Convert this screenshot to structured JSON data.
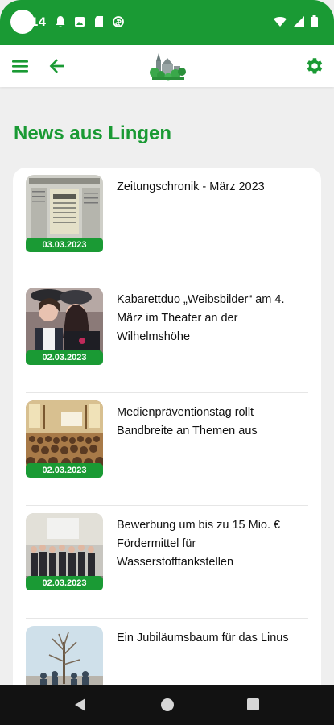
{
  "status_bar": {
    "time": "14",
    "icons": [
      "notification-bell-icon",
      "photo-icon",
      "sd-card-icon",
      "coin-icon"
    ],
    "right_icons": [
      "wifi-icon",
      "signal-icon",
      "battery-icon"
    ]
  },
  "app_bar": {
    "icons": [
      "menu-icon",
      "back-arrow-icon",
      "city-logo",
      "gear-icon"
    ]
  },
  "page": {
    "title": "News aus Lingen"
  },
  "news": [
    {
      "title": "Zeitungschronik - März 2023",
      "date": "03.03.2023"
    },
    {
      "title": "Kabarettduo „Weibsbilder“ am 4. März im Theater an der Wilhelmshöhe",
      "date": "02.03.2023"
    },
    {
      "title": "Medienpräventionstag rollt Bandbreite an Themen aus",
      "date": "02.03.2023"
    },
    {
      "title": "Bewerbung um bis zu 15 Mio. € Fördermittel für Wasserstofftankstellen",
      "date": "02.03.2023"
    },
    {
      "title": "Ein Jubiläumsbaum für das Linus",
      "date": ""
    }
  ],
  "colors": {
    "accent": "#1a9a34",
    "background": "#efefef",
    "card": "#ffffff",
    "navbar": "#121212"
  }
}
